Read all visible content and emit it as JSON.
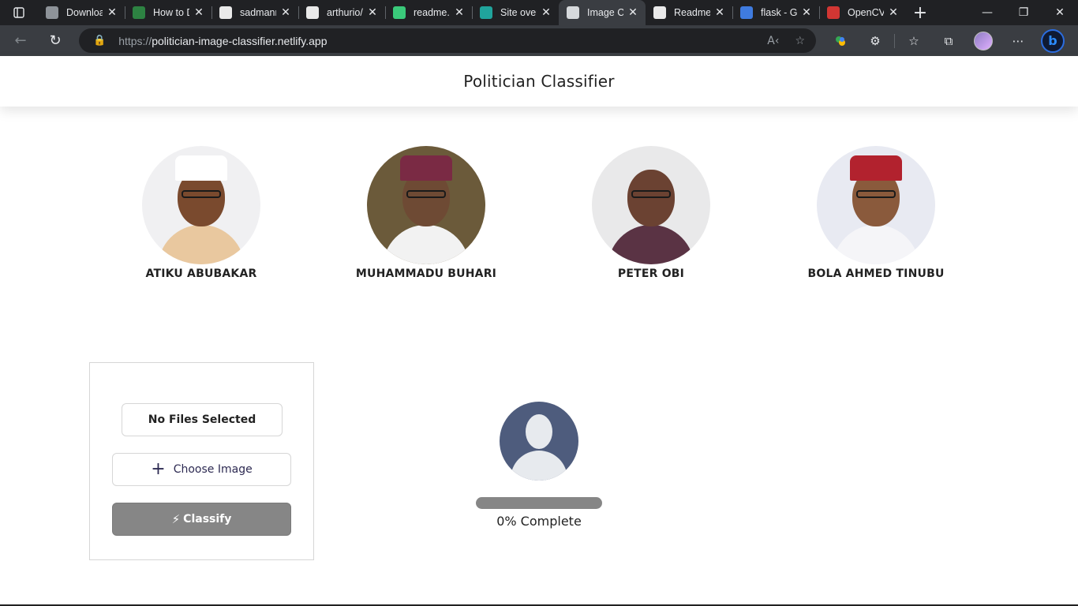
{
  "browser": {
    "tabs": [
      {
        "title": "Downloa",
        "favicon": "download-page-icon",
        "color": "#9aa0a6",
        "active": false
      },
      {
        "title": "How to D",
        "favicon": "geeksforgeeks-icon",
        "color": "#2f8d46",
        "active": false
      },
      {
        "title": "sadmanr",
        "favicon": "github-icon",
        "color": "#ffffff",
        "active": false
      },
      {
        "title": "arthurio/",
        "favicon": "github-icon",
        "color": "#ffffff",
        "active": false
      },
      {
        "title": "readme.",
        "favicon": "readme-icon",
        "color": "#3ddc84",
        "active": false
      },
      {
        "title": "Site over",
        "favicon": "netlify-icon",
        "color": "#20b2aa",
        "active": false
      },
      {
        "title": "Image C",
        "favicon": "page-icon",
        "color": "#e8eaed",
        "active": true
      },
      {
        "title": "Readme",
        "favicon": "dev-icon",
        "color": "#ffffff",
        "active": false
      },
      {
        "title": "flask - G",
        "favicon": "google-icon",
        "color": "#4285f4",
        "active": false
      },
      {
        "title": "OpenCV",
        "favicon": "opencv-icon",
        "color": "#e53935",
        "active": false
      }
    ],
    "url_scheme": "https://",
    "url_host": "politician-image-classifier.netlify.app"
  },
  "site": {
    "title": "Politician Classifier"
  },
  "politicians": [
    {
      "name": "ATIKU ABUBAKAR",
      "bg": "#f0f0f2",
      "body": "#e9c89f",
      "skin": "#7a4a2e",
      "hat": "#ffffff"
    },
    {
      "name": "MUHAMMADU BUHARI",
      "bg": "#6b5a3a",
      "body": "#f2f2f2",
      "skin": "#6e4a34",
      "hat": "#7a2a44"
    },
    {
      "name": "PETER OBI",
      "bg": "#e9e9ea",
      "body": "#5a3344",
      "skin": "#6b4232",
      "hat": ""
    },
    {
      "name": "BOLA AHMED TINUBU",
      "bg": "#e8eaf2",
      "body": "#f5f5f8",
      "skin": "#8a5a3c",
      "hat": "#b2222e"
    }
  ],
  "upload": {
    "file_status": "No Files Selected",
    "choose_label": "Choose Image",
    "classify_label": "Classify"
  },
  "result": {
    "progress_percent": 0,
    "progress_label": "0% Complete"
  }
}
